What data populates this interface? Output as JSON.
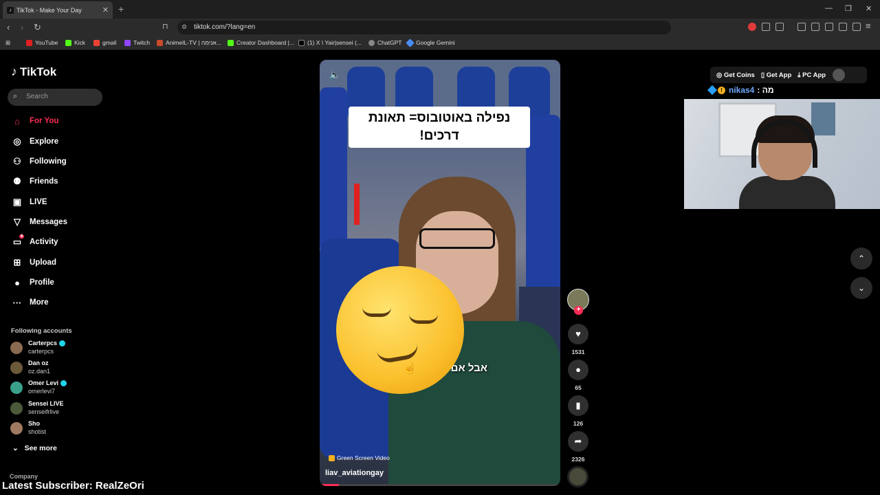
{
  "browser": {
    "tab_title": "TikTok - Make Your Day",
    "url": "tiktok.com/?lang=en",
    "bookmarks": [
      "YouTube",
      "Kick",
      "gmail",
      "Twitch",
      "AnimeIL-TV | אנימה...",
      "Creator Dashboard |...",
      "(1) X \\ Yair|sensei (...",
      "ChatGPT",
      "Google Gemini"
    ]
  },
  "sidebar": {
    "logo": "TikTok",
    "search_placeholder": "Search",
    "nav": [
      {
        "label": "For You",
        "icon": "home-icon"
      },
      {
        "label": "Explore",
        "icon": "compass-icon"
      },
      {
        "label": "Following",
        "icon": "following-icon"
      },
      {
        "label": "Friends",
        "icon": "friends-icon"
      },
      {
        "label": "LIVE",
        "icon": "live-icon"
      },
      {
        "label": "Messages",
        "icon": "messages-icon"
      },
      {
        "label": "Activity",
        "icon": "activity-icon"
      },
      {
        "label": "Upload",
        "icon": "upload-icon"
      },
      {
        "label": "Profile",
        "icon": "profile-icon"
      },
      {
        "label": "More",
        "icon": "more-icon"
      }
    ],
    "activity_badge": "6",
    "following_title": "Following accounts",
    "accounts": [
      {
        "name": "Carterpcs",
        "handle": "carterpcs",
        "verified": true
      },
      {
        "name": "Dan oz",
        "handle": "oz.dan1",
        "verified": false
      },
      {
        "name": "Omer Levi",
        "handle": "omerlevi7",
        "verified": true
      },
      {
        "name": "Sensei LIVE",
        "handle": "senseifrlive",
        "verified": false
      },
      {
        "name": "Sho",
        "handle": "shotist",
        "verified": false
      }
    ],
    "see_more": "See more",
    "company": "Company"
  },
  "overlay": {
    "subscriber": "Latest Subscriber: RealZeOri",
    "chat_user": "nikas4",
    "chat_text": ": מה"
  },
  "video": {
    "caption": "נפילה באוטובוס= תאונת דרכים!",
    "subtitle": "אבל אם נ",
    "effect_label": "Green Screen Video",
    "username": "liav_aviationgay",
    "progress_fraction": 0.08
  },
  "actions": {
    "likes": "1531",
    "comments": "65",
    "saves": "126",
    "shares": "2326"
  },
  "topbar": {
    "get_coins": "Get Coins",
    "get_app": "Get App",
    "pc_app": "PC App"
  }
}
